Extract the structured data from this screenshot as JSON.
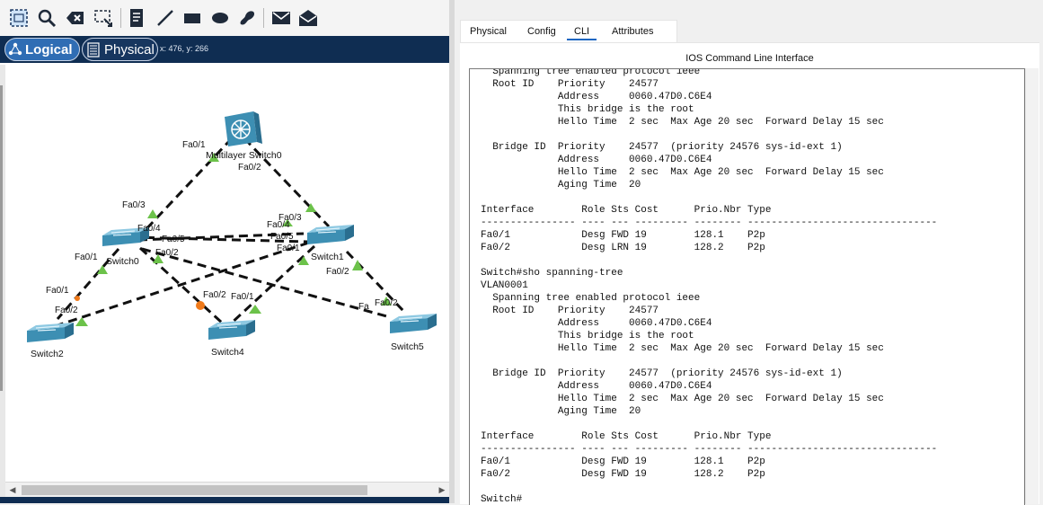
{
  "toolbar": {
    "tools": [
      "select-tool",
      "inspect-tool",
      "delete-tool",
      "resize-shape-tool",
      "place-note-tool",
      "draw-line-tool",
      "draw-rectangle-tool",
      "draw-ellipse-tool",
      "freeform-tool",
      "add-simple-pdu-tool",
      "add-complex-pdu-tool"
    ]
  },
  "modebar": {
    "logical_label": "Logical",
    "physical_label": "Physical",
    "coords": "x: 476, y: 266"
  },
  "topology": {
    "devices": {
      "mls0": "Multilayer Switch0",
      "switch0": "Switch0",
      "switch1": "Switch1",
      "switch2": "Switch2",
      "switch4": "Switch4",
      "switch5": "Switch5"
    },
    "ports": {
      "mls_fa01": "Fa0/1",
      "mls_fa02": "Fa0/2",
      "s0_fa03": "Fa0/3",
      "s0_fa04": "Fa0/4",
      "s0_fa05": "Fa0/5",
      "s0_fa01": "Fa0/1",
      "s0_fa02": "Fa0/2",
      "s1_fa03": "Fa0/3",
      "s1_fa04": "Fa0/4",
      "s1_fa05": "Fa0/5",
      "s1_fa01": "Fa0/1",
      "s1_fa02": "Fa0/2",
      "s2_fa01": "Fa0/1",
      "s2_fa02": "Fa0/2",
      "s4_fa02": "Fa0/2",
      "s4_fa01": "Fa0/1",
      "s5_fa01": "Fa",
      "s5_fa02": "Fa0/2"
    },
    "colors": {
      "link_up": "#6cc24a",
      "link_blocking": "#f07a1a",
      "device": "#3d8fb3"
    }
  },
  "cli_window": {
    "tabs": [
      "Physical",
      "Config",
      "CLI",
      "Attributes"
    ],
    "active_tab": "CLI",
    "title": "IOS Command Line Interface",
    "lines": [
      "  Spanning tree enabled protocol ieee",
      "  Root ID    Priority    24577",
      "             Address     0060.47D0.C6E4",
      "             This bridge is the root",
      "             Hello Time  2 sec  Max Age 20 sec  Forward Delay 15 sec",
      "",
      "  Bridge ID  Priority    24577  (priority 24576 sys-id-ext 1)",
      "             Address     0060.47D0.C6E4",
      "             Hello Time  2 sec  Max Age 20 sec  Forward Delay 15 sec",
      "             Aging Time  20",
      "",
      "Interface        Role Sts Cost      Prio.Nbr Type",
      "---------------- ---- --- --------- -------- --------------------------------",
      "Fa0/1            Desg FWD 19        128.1    P2p",
      "Fa0/2            Desg LRN 19        128.2    P2p",
      "",
      "Switch#sho spanning-tree",
      "VLAN0001",
      "  Spanning tree enabled protocol ieee",
      "  Root ID    Priority    24577",
      "             Address     0060.47D0.C6E4",
      "             This bridge is the root",
      "             Hello Time  2 sec  Max Age 20 sec  Forward Delay 15 sec",
      "",
      "  Bridge ID  Priority    24577  (priority 24576 sys-id-ext 1)",
      "             Address     0060.47D0.C6E4",
      "             Hello Time  2 sec  Max Age 20 sec  Forward Delay 15 sec",
      "             Aging Time  20",
      "",
      "Interface        Role Sts Cost      Prio.Nbr Type",
      "---------------- ---- --- --------- -------- --------------------------------",
      "Fa0/1            Desg FWD 19        128.1    P2p",
      "Fa0/2            Desg FWD 19        128.2    P2p",
      "",
      "Switch#"
    ]
  }
}
